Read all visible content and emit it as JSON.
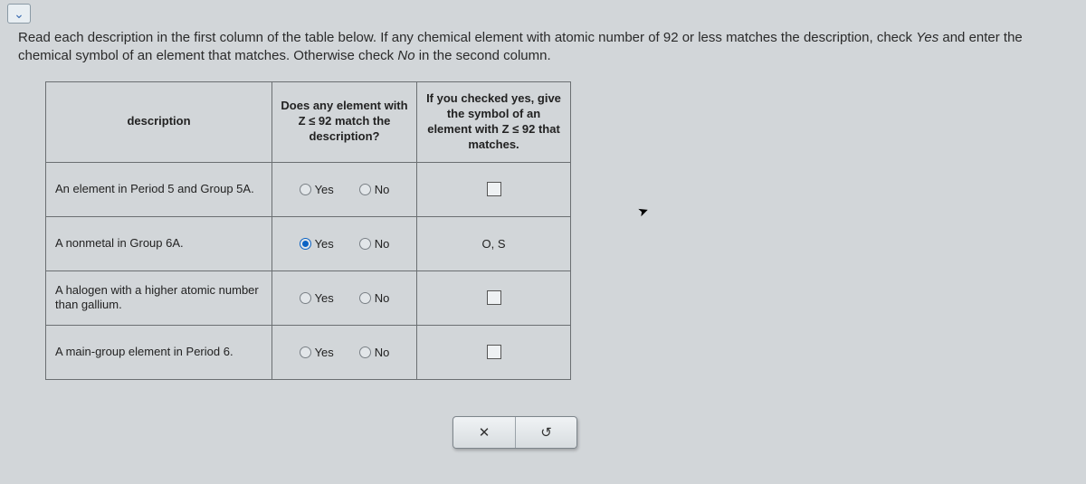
{
  "expand_icon": "⌄",
  "instructions": {
    "line1_a": "Read each description in the first column of the table below. If any chemical element with atomic number of 92 or less matches the description, check ",
    "yes": "Yes",
    "line1_b": " and enter the chemical symbol of an element that matches. Otherwise check ",
    "no": "No",
    "line1_c": " in the second column."
  },
  "headers": {
    "description": "description",
    "match": "Does any element with Z ≤ 92 match the description?",
    "symbol": "If you checked yes, give the symbol of an element with Z ≤ 92 that matches."
  },
  "yes_label": "Yes",
  "no_label": "No",
  "rows": [
    {
      "desc": "An element in Period 5 and Group 5A.",
      "selected": "",
      "symbol": ""
    },
    {
      "desc": "A nonmetal in Group 6A.",
      "selected": "yes",
      "symbol": "O, S"
    },
    {
      "desc": "A halogen with a higher atomic number than gallium.",
      "selected": "",
      "symbol": ""
    },
    {
      "desc": "A main-group element in Period 6.",
      "selected": "",
      "symbol": ""
    }
  ],
  "toolbar": {
    "clear": "✕",
    "undo": "↺"
  },
  "chart_data": {
    "type": "table",
    "title": "Element description matching (Z ≤ 92)",
    "columns": [
      "description",
      "Does any element with Z ≤ 92 match the description?",
      "If you checked yes, give the symbol of an element with Z ≤ 92 that matches."
    ],
    "rows": [
      [
        "An element in Period 5 and Group 5A.",
        null,
        null
      ],
      [
        "A nonmetal in Group 6A.",
        "Yes",
        "O, S"
      ],
      [
        "A halogen with a higher atomic number than gallium.",
        null,
        null
      ],
      [
        "A main-group element in Period 6.",
        null,
        null
      ]
    ]
  }
}
